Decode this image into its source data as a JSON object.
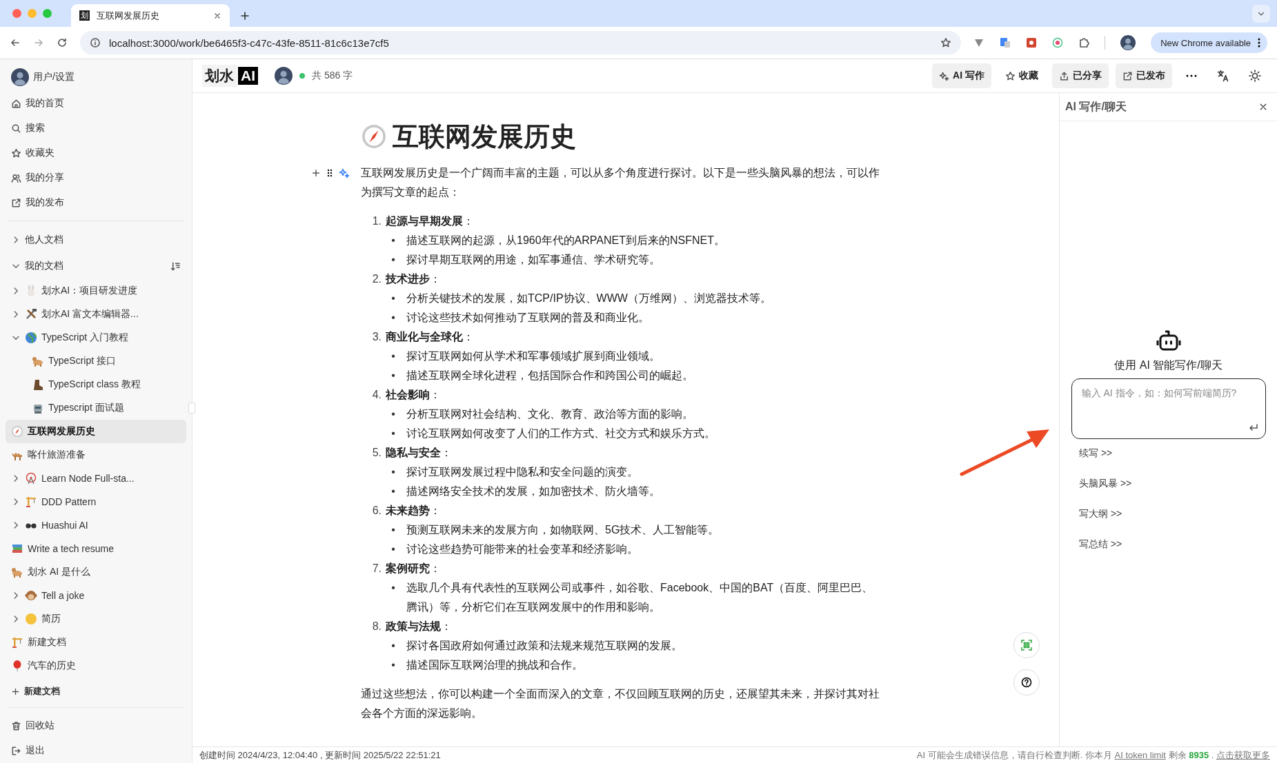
{
  "browser": {
    "tab_favicon": "划",
    "tab_title": "互联网发展历史",
    "url": "localhost:3000/work/be6465f3-c47c-43fe-8511-81c6c13e7cf5",
    "update_button": "New Chrome available"
  },
  "sidebar": {
    "user": "用户/设置",
    "nav": [
      "我的首页",
      "搜索",
      "收藏夹",
      "我的分享",
      "我的发布"
    ],
    "groups": [
      {
        "label": "他人文档",
        "expanded": false
      },
      {
        "label": "我的文档",
        "expanded": true,
        "docs": [
          {
            "title": "划水AI：项目研发进度",
            "kind": "folder",
            "expanded": false,
            "selected": false
          },
          {
            "title": "划水AI 富文本编辑器...",
            "kind": "folder",
            "expanded": false,
            "selected": false
          },
          {
            "title": "TypeScript 入门教程",
            "kind": "folder",
            "expanded": true,
            "selected": false,
            "children": [
              {
                "title": "TypeScript 接口",
                "kind": "page",
                "selected": false
              },
              {
                "title": "TypeScript class 教程",
                "kind": "page",
                "selected": false
              },
              {
                "title": "Typescript 面试题",
                "kind": "page",
                "selected": false
              }
            ]
          },
          {
            "title": "互联网发展历史",
            "kind": "page",
            "selected": true
          },
          {
            "title": "喀什旅游准备",
            "kind": "page",
            "selected": false
          },
          {
            "title": "Learn Node Full-sta...",
            "kind": "folder",
            "expanded": false,
            "selected": false
          },
          {
            "title": "DDD Pattern",
            "kind": "folder",
            "expanded": false,
            "selected": false
          },
          {
            "title": "Huashui AI",
            "kind": "folder",
            "expanded": false,
            "selected": false
          },
          {
            "title": "Write a tech resume",
            "kind": "page",
            "selected": false
          },
          {
            "title": "划水 AI 是什么",
            "kind": "page",
            "selected": false
          },
          {
            "title": "Tell a joke",
            "kind": "folder",
            "expanded": false,
            "selected": false
          },
          {
            "title": "简历",
            "kind": "folder",
            "expanded": false,
            "selected": false
          },
          {
            "title": "新建文档",
            "kind": "page",
            "selected": false
          },
          {
            "title": "汽车的历史",
            "kind": "page",
            "selected": false
          }
        ]
      }
    ],
    "new_doc": "新建文档",
    "bottom": [
      "回收站",
      "退出"
    ]
  },
  "header": {
    "logo": "划水",
    "logo_badge": "AI",
    "online": true,
    "word_count": "共 586 字",
    "actions": [
      {
        "label": "AI 写作",
        "active": true
      },
      {
        "label": "收藏",
        "active": false
      },
      {
        "label": "已分享",
        "active": true
      },
      {
        "label": "已发布",
        "active": true
      }
    ]
  },
  "document": {
    "title": "互联网发展历史",
    "intro": "互联网发展历史是一个广阔而丰富的主题，可以从多个角度进行探讨。以下是一些头脑风暴的想法，可以作为撰写文章的起点：",
    "sections": [
      {
        "number": "1.",
        "heading": "**起源与早期发展**：",
        "bullets": [
          {
            "marker": "•",
            "text": "描述互联网的起源，从1960年代的ARPANET到后来的NSFNET。"
          },
          {
            "marker": "•",
            "text": "探讨早期互联网的用途，如军事通信、学术研究等。"
          }
        ]
      },
      {
        "number": "2.",
        "heading": "**技术进步**：",
        "bullets": [
          {
            "marker": "•",
            "text": "分析关键技术的发展，如TCP/IP协议、WWW（万维网）、浏览器技术等。"
          },
          {
            "marker": "•",
            "text": "讨论这些技术如何推动了互联网的普及和商业化。"
          }
        ]
      },
      {
        "number": "3.",
        "heading": "**商业化与全球化**：",
        "bullets": [
          {
            "marker": "•",
            "text": "探讨互联网如何从学术和军事领域扩展到商业领域。"
          },
          {
            "marker": "•",
            "text": "描述互联网全球化进程，包括国际合作和跨国公司的崛起。"
          }
        ]
      },
      {
        "number": "4.",
        "heading": "**社会影响**：",
        "bullets": [
          {
            "marker": "•",
            "text": "分析互联网对社会结构、文化、教育、政治等方面的影响。"
          },
          {
            "marker": "•",
            "text": "讨论互联网如何改变了人们的工作方式、社交方式和娱乐方式。"
          }
        ]
      },
      {
        "number": "5.",
        "heading": "**隐私与安全**：",
        "bullets": [
          {
            "marker": "•",
            "text": "探讨互联网发展过程中隐私和安全问题的演变。"
          },
          {
            "marker": "•",
            "text": "描述网络安全技术的发展，如加密技术、防火墙等。"
          }
        ]
      },
      {
        "number": "6.",
        "heading": "**未来趋势**：",
        "bullets": [
          {
            "marker": "•",
            "text": "预测互联网未来的发展方向，如物联网、5G技术、人工智能等。"
          },
          {
            "marker": "•",
            "text": "讨论这些趋势可能带来的社会变革和经济影响。"
          }
        ]
      },
      {
        "number": "7.",
        "heading": "**案例研究**：",
        "bullets": [
          {
            "marker": "•",
            "text": "选取几个具有代表性的互联网公司或事件，如谷歌、Facebook、中国的BAT（百度、阿里巴巴、腾讯）等，分析它们在互联网发展中的作用和影响。"
          }
        ]
      },
      {
        "number": "8.",
        "heading": "**政策与法规**：",
        "bullets": [
          {
            "marker": "•",
            "text": "探讨各国政府如何通过政策和法规来规范互联网的发展。"
          },
          {
            "marker": "•",
            "text": "描述国际互联网治理的挑战和合作。"
          }
        ]
      }
    ],
    "conclusion": "通过这些想法，你可以构建一个全面而深入的文章，不仅回顾互联网的历史，还展望其未来，并探讨其对社会各个方面的深远影响。"
  },
  "ai_panel": {
    "title": "AI 写作/聊天",
    "prompt": "使用 AI 智能写作/聊天",
    "input": {
      "placeholder": "输入 AI 指令，如：如何写前端简历?"
    },
    "actions": [
      "续写 >>",
      "头脑风暴 >>",
      "写大纲 >>",
      "写总结 >>"
    ]
  },
  "footer": {
    "timestamps": "创建时间 2024/4/23, 12:04:40 , 更新时间 2025/5/22 22:51:21",
    "notice": "AI 可能会生成错误信息，请自行检查判断. 你本月",
    "limit_link": "AI token limit",
    "remaining_label": "剩余",
    "remaining": "8935",
    "separator": ".",
    "more_link": "点击获取更多"
  }
}
